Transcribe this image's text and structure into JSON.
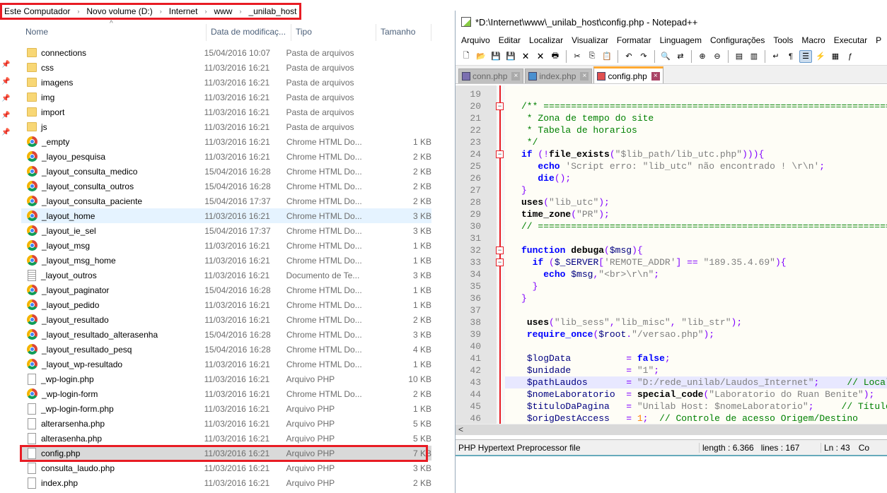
{
  "explorer": {
    "breadcrumb": [
      "Este Computador",
      "Novo volume (D:)",
      "Internet",
      "www",
      "_unilab_host"
    ],
    "columns": {
      "name": "Nome",
      "date": "Data de modificaç...",
      "type": "Tipo",
      "size": "Tamanho"
    },
    "files": [
      {
        "name": "connections",
        "date": "15/04/2016 10:07",
        "type": "Pasta de arquivos",
        "size": "",
        "icon": "folder"
      },
      {
        "name": "css",
        "date": "11/03/2016 16:21",
        "type": "Pasta de arquivos",
        "size": "",
        "icon": "folder"
      },
      {
        "name": "imagens",
        "date": "11/03/2016 16:21",
        "type": "Pasta de arquivos",
        "size": "",
        "icon": "folder"
      },
      {
        "name": "img",
        "date": "11/03/2016 16:21",
        "type": "Pasta de arquivos",
        "size": "",
        "icon": "folder"
      },
      {
        "name": "import",
        "date": "11/03/2016 16:21",
        "type": "Pasta de arquivos",
        "size": "",
        "icon": "folder"
      },
      {
        "name": "js",
        "date": "11/03/2016 16:21",
        "type": "Pasta de arquivos",
        "size": "",
        "icon": "folder"
      },
      {
        "name": "_empty",
        "date": "11/03/2016 16:21",
        "type": "Chrome HTML Do...",
        "size": "1 KB",
        "icon": "chrome"
      },
      {
        "name": "_layou_pesquisa",
        "date": "11/03/2016 16:21",
        "type": "Chrome HTML Do...",
        "size": "2 KB",
        "icon": "chrome"
      },
      {
        "name": "_layout_consulta_medico",
        "date": "15/04/2016 16:28",
        "type": "Chrome HTML Do...",
        "size": "2 KB",
        "icon": "chrome"
      },
      {
        "name": "_layout_consulta_outros",
        "date": "15/04/2016 16:28",
        "type": "Chrome HTML Do...",
        "size": "2 KB",
        "icon": "chrome"
      },
      {
        "name": "_layout_consulta_paciente",
        "date": "15/04/2016 17:37",
        "type": "Chrome HTML Do...",
        "size": "2 KB",
        "icon": "chrome"
      },
      {
        "name": "_layout_home",
        "date": "11/03/2016 16:21",
        "type": "Chrome HTML Do...",
        "size": "3 KB",
        "icon": "chrome",
        "state": "hover"
      },
      {
        "name": "_layout_ie_sel",
        "date": "15/04/2016 17:37",
        "type": "Chrome HTML Do...",
        "size": "3 KB",
        "icon": "chrome"
      },
      {
        "name": "_layout_msg",
        "date": "11/03/2016 16:21",
        "type": "Chrome HTML Do...",
        "size": "1 KB",
        "icon": "chrome"
      },
      {
        "name": "_layout_msg_home",
        "date": "11/03/2016 16:21",
        "type": "Chrome HTML Do...",
        "size": "1 KB",
        "icon": "chrome"
      },
      {
        "name": "_layout_outros",
        "date": "11/03/2016 16:21",
        "type": "Documento de Te...",
        "size": "3 KB",
        "icon": "txt"
      },
      {
        "name": "_layout_paginator",
        "date": "15/04/2016 16:28",
        "type": "Chrome HTML Do...",
        "size": "1 KB",
        "icon": "chrome"
      },
      {
        "name": "_layout_pedido",
        "date": "11/03/2016 16:21",
        "type": "Chrome HTML Do...",
        "size": "1 KB",
        "icon": "chrome"
      },
      {
        "name": "_layout_resultado",
        "date": "11/03/2016 16:21",
        "type": "Chrome HTML Do...",
        "size": "2 KB",
        "icon": "chrome"
      },
      {
        "name": "_layout_resultado_alterasenha",
        "date": "15/04/2016 16:28",
        "type": "Chrome HTML Do...",
        "size": "3 KB",
        "icon": "chrome"
      },
      {
        "name": "_layout_resultado_pesq",
        "date": "15/04/2016 16:28",
        "type": "Chrome HTML Do...",
        "size": "4 KB",
        "icon": "chrome"
      },
      {
        "name": "_layout_wp-resultado",
        "date": "11/03/2016 16:21",
        "type": "Chrome HTML Do...",
        "size": "1 KB",
        "icon": "chrome"
      },
      {
        "name": "_wp-login.php",
        "date": "11/03/2016 16:21",
        "type": "Arquivo PHP",
        "size": "10 KB",
        "icon": "file"
      },
      {
        "name": "_wp-login-form",
        "date": "11/03/2016 16:21",
        "type": "Chrome HTML Do...",
        "size": "2 KB",
        "icon": "chrome"
      },
      {
        "name": "_wp-login-form.php",
        "date": "11/03/2016 16:21",
        "type": "Arquivo PHP",
        "size": "1 KB",
        "icon": "file"
      },
      {
        "name": "alterarsenha.php",
        "date": "11/03/2016 16:21",
        "type": "Arquivo PHP",
        "size": "5 KB",
        "icon": "file"
      },
      {
        "name": "alterasenha.php",
        "date": "11/03/2016 16:21",
        "type": "Arquivo PHP",
        "size": "5 KB",
        "icon": "file"
      },
      {
        "name": "config.php",
        "date": "11/03/2016 16:21",
        "type": "Arquivo PHP",
        "size": "7 KB",
        "icon": "file",
        "state": "selected"
      },
      {
        "name": "consulta_laudo.php",
        "date": "11/03/2016 16:21",
        "type": "Arquivo PHP",
        "size": "3 KB",
        "icon": "file"
      },
      {
        "name": "index.php",
        "date": "11/03/2016 16:21",
        "type": "Arquivo PHP",
        "size": "2 KB",
        "icon": "file"
      }
    ]
  },
  "notepad": {
    "title": "*D:\\Internet\\www\\_unilab_host\\config.php - Notepad++",
    "menu": [
      "Arquivo",
      "Editar",
      "Localizar",
      "Visualizar",
      "Formatar",
      "Linguagem",
      "Configurações",
      "Tools",
      "Macro",
      "Executar",
      "P"
    ],
    "toolbar_icons": [
      "new-file-icon",
      "open-file-icon",
      "save-icon",
      "save-all-icon",
      "close-icon",
      "close-all-icon",
      "print-icon",
      "|",
      "cut-icon",
      "copy-icon",
      "paste-icon",
      "|",
      "undo-icon",
      "redo-icon",
      "|",
      "find-icon",
      "replace-icon",
      "|",
      "zoom-in-icon",
      "zoom-out-icon",
      "|",
      "sync-vertical-icon",
      "sync-horizontal-icon",
      "|",
      "word-wrap-icon",
      "show-all-chars-icon",
      "indent-guide-icon",
      "udl-icon",
      "doc-map-icon",
      "function-list-icon"
    ],
    "tabs": [
      {
        "label": "conn.php",
        "color": "#7b6fb0"
      },
      {
        "label": "index.php",
        "color": "#4a90d0"
      },
      {
        "label": "config.php",
        "color": "#e05050",
        "active": true
      }
    ],
    "current_line": 43,
    "code": [
      {
        "n": 19,
        "t": []
      },
      {
        "n": 20,
        "fold": true,
        "t": [
          [
            "cm",
            "/** ========================================================================"
          ]
        ]
      },
      {
        "n": 21,
        "t": [
          [
            "cm",
            " * Zona de tempo do site"
          ]
        ]
      },
      {
        "n": 22,
        "t": [
          [
            "cm",
            " * Tabela de horarios"
          ]
        ]
      },
      {
        "n": 23,
        "t": [
          [
            "cm",
            " */"
          ]
        ]
      },
      {
        "n": 24,
        "fold": true,
        "t": [
          [
            "kw",
            "if"
          ],
          [
            "",
            " "
          ],
          [
            "op",
            "(!"
          ],
          [
            "fn",
            "file_exists"
          ],
          [
            "op",
            "("
          ],
          [
            "st",
            "\"$lib_path/lib_utc.php\""
          ],
          [
            "op",
            "))){"
          ]
        ]
      },
      {
        "n": 25,
        "t": [
          [
            "",
            "   "
          ],
          [
            "kw",
            "echo"
          ],
          [
            "",
            " "
          ],
          [
            "st",
            "'Script erro: \"lib_utc\" não encontrado ! \\r\\n'"
          ],
          [
            "op",
            ";"
          ]
        ]
      },
      {
        "n": 26,
        "t": [
          [
            "",
            "   "
          ],
          [
            "kw",
            "die"
          ],
          [
            "op",
            "();"
          ]
        ]
      },
      {
        "n": 27,
        "t": [
          [
            "op",
            "}"
          ]
        ]
      },
      {
        "n": 28,
        "t": [
          [
            "fn",
            "uses"
          ],
          [
            "op",
            "("
          ],
          [
            "st",
            "\"lib_utc\""
          ],
          [
            "op",
            ");"
          ]
        ]
      },
      {
        "n": 29,
        "t": [
          [
            "fn",
            "time_zone"
          ],
          [
            "op",
            "("
          ],
          [
            "st",
            "\"PR\""
          ],
          [
            "op",
            ");"
          ]
        ]
      },
      {
        "n": 30,
        "t": [
          [
            "cm",
            "// ========================================================================"
          ]
        ]
      },
      {
        "n": 31,
        "t": []
      },
      {
        "n": 32,
        "fold": true,
        "t": [
          [
            "kw",
            "function"
          ],
          [
            "",
            " "
          ],
          [
            "fn",
            "debuga"
          ],
          [
            "op",
            "("
          ],
          [
            "vr",
            "$msg"
          ],
          [
            "op",
            "){"
          ]
        ]
      },
      {
        "n": 33,
        "fold": true,
        "t": [
          [
            "",
            "  "
          ],
          [
            "kw",
            "if"
          ],
          [
            "",
            " "
          ],
          [
            "op",
            "("
          ],
          [
            "vr",
            "$_SERVER"
          ],
          [
            "op",
            "["
          ],
          [
            "st",
            "'REMOTE_ADDR'"
          ],
          [
            "op",
            "] == "
          ],
          [
            "st",
            "\"189.35.4.69\""
          ],
          [
            "op",
            "){"
          ]
        ]
      },
      {
        "n": 34,
        "t": [
          [
            "",
            "    "
          ],
          [
            "kw",
            "echo"
          ],
          [
            "",
            " "
          ],
          [
            "vr",
            "$msg"
          ],
          [
            "op",
            ","
          ],
          [
            "st",
            "\"<br>\\r\\n\""
          ],
          [
            "op",
            ";"
          ]
        ]
      },
      {
        "n": 35,
        "t": [
          [
            "",
            "  "
          ],
          [
            "op",
            "}"
          ]
        ]
      },
      {
        "n": 36,
        "t": [
          [
            "op",
            "}"
          ]
        ]
      },
      {
        "n": 37,
        "t": []
      },
      {
        "n": 38,
        "t": [
          [
            "",
            " "
          ],
          [
            "fn",
            "uses"
          ],
          [
            "op",
            "("
          ],
          [
            "st",
            "\"lib_sess\""
          ],
          [
            "op",
            ","
          ],
          [
            "st",
            "\"lib_misc\""
          ],
          [
            "op",
            ", "
          ],
          [
            "st",
            "\"lib_str\""
          ],
          [
            "op",
            ");"
          ]
        ]
      },
      {
        "n": 39,
        "t": [
          [
            "",
            " "
          ],
          [
            "kw",
            "require_once"
          ],
          [
            "op",
            "("
          ],
          [
            "vr",
            "$root"
          ],
          [
            "op",
            "."
          ],
          [
            "st",
            "\"/versao.php\""
          ],
          [
            "op",
            ");"
          ]
        ]
      },
      {
        "n": 40,
        "t": []
      },
      {
        "n": 41,
        "t": [
          [
            "",
            " "
          ],
          [
            "vr",
            "$logData"
          ],
          [
            "",
            "          "
          ],
          [
            "op",
            "= "
          ],
          [
            "kw",
            "false"
          ],
          [
            "op",
            ";"
          ]
        ]
      },
      {
        "n": 42,
        "t": [
          [
            "",
            " "
          ],
          [
            "vr",
            "$unidade"
          ],
          [
            "",
            "          "
          ],
          [
            "op",
            "= "
          ],
          [
            "st",
            "\"1\""
          ],
          [
            "op",
            ";"
          ]
        ]
      },
      {
        "n": 43,
        "t": [
          [
            "",
            " "
          ],
          [
            "vr",
            "$pathLaudos"
          ],
          [
            "",
            "       "
          ],
          [
            "op",
            "= "
          ],
          [
            "st",
            "\"D:/rede_unilab/Laudos_Internet\""
          ],
          [
            "op",
            ";"
          ],
          [
            "",
            "     "
          ],
          [
            "cm",
            "// Local"
          ]
        ]
      },
      {
        "n": 44,
        "t": [
          [
            "",
            " "
          ],
          [
            "vr",
            "$nomeLaboratorio"
          ],
          [
            "",
            "  "
          ],
          [
            "op",
            "= "
          ],
          [
            "fn",
            "special_code"
          ],
          [
            "op",
            "("
          ],
          [
            "st",
            "\"Laboratorio do Ruan Benite\""
          ],
          [
            "op",
            ");"
          ]
        ]
      },
      {
        "n": 45,
        "t": [
          [
            "",
            " "
          ],
          [
            "vr",
            "$tituloDaPagina"
          ],
          [
            "",
            "   "
          ],
          [
            "op",
            "= "
          ],
          [
            "st",
            "\"Unilab Host: $nomeLaboratorio\""
          ],
          [
            "op",
            ";"
          ],
          [
            "",
            "     "
          ],
          [
            "cm",
            "// Título"
          ]
        ]
      },
      {
        "n": 46,
        "t": [
          [
            "",
            " "
          ],
          [
            "vr",
            "$origDestAccess"
          ],
          [
            "",
            "   "
          ],
          [
            "op",
            "= "
          ],
          [
            "nm",
            "1"
          ],
          [
            "op",
            ";"
          ],
          [
            "",
            "  "
          ],
          [
            "cm",
            "// Controle de acesso Origem/Destino"
          ]
        ]
      }
    ],
    "status": {
      "filetype": "PHP Hypertext Preprocessor file",
      "length": "length : 6.366",
      "lines": "lines : 167",
      "ln": "Ln : 43",
      "col": "Co"
    }
  },
  "colors": {
    "highlight": "#e81c24",
    "selected_row": "#d9d9d9",
    "hover_row": "#e5f3ff"
  }
}
